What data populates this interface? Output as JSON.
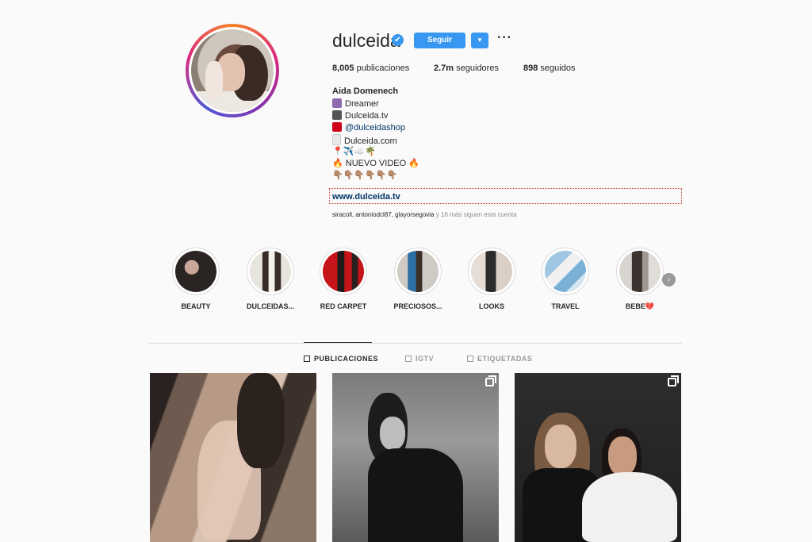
{
  "profile": {
    "username": "dulceida",
    "verified_glyph": "✔",
    "follow_label": "Seguir",
    "dropdown_glyph": "▼",
    "more_glyph": "···",
    "stats": {
      "posts_value": "8,005",
      "posts_label": "publicaciones",
      "followers_value": "2.7m",
      "followers_label": "seguidores",
      "following_value": "898",
      "following_label": "seguidos"
    },
    "bio": {
      "name": "Aida Domenech",
      "lines": [
        "Dreamer",
        "Dulceida.tv",
        "@dulceidashop",
        "Dulceida.com",
        "📍✈️☁️🌴",
        "🔥 NUEVO VIDEO 🔥",
        "👇🏽👇🏽👇🏽👇🏽👇🏽👇🏽"
      ],
      "website": "www.dulceida.tv",
      "followed_by_names": "siracoll, antoniodcl87, glayorsegovia",
      "followed_by_rest": "y 16 más siguen esta cuenta"
    }
  },
  "highlights": [
    {
      "label": "BEAUTY"
    },
    {
      "label": "DULCEIDAS..."
    },
    {
      "label": "RED CARPET"
    },
    {
      "label": "PRECIOSOS..."
    },
    {
      "label": "LOOKS"
    },
    {
      "label": "TRAVEL"
    },
    {
      "label": "BEBE💔"
    }
  ],
  "next_glyph": "›",
  "tabs": [
    {
      "label": "PUBLICACIONES",
      "active": true
    },
    {
      "label": "IGTV",
      "active": false
    },
    {
      "label": "ETIQUETADAS",
      "active": false
    }
  ],
  "posts": [
    {
      "multi": false
    },
    {
      "multi": true
    },
    {
      "multi": true
    }
  ],
  "colors": {
    "accent": "#3897f0",
    "link": "#003569",
    "background": "#fafafa"
  }
}
